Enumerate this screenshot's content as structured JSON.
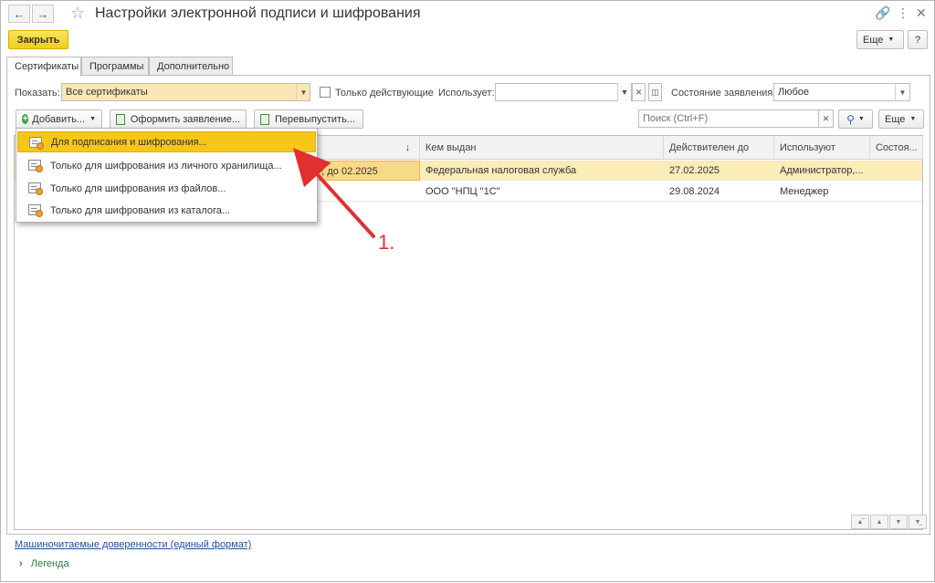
{
  "window": {
    "title": "Настройки электронной подписи и шифрования"
  },
  "commandbar": {
    "close_label": "Закрыть",
    "more_label": "Еще",
    "help_label": "?"
  },
  "tabs": [
    {
      "label": "Сертификаты",
      "active": true
    },
    {
      "label": "Программы",
      "active": false
    },
    {
      "label": "Дополнительно",
      "active": false
    }
  ],
  "filters": {
    "show_label": "Показать:",
    "show_value": "Все сертификаты",
    "only_active_label": "Только действующие",
    "uses_label": "Использует:",
    "uses_value": "",
    "status_label": "Состояние заявления:",
    "status_value": "Любое"
  },
  "toolbar": {
    "add_label": "Добавить...",
    "apply_label": "Оформить заявление...",
    "reissue_label": "Перевыпустить...",
    "search_placeholder": "Поиск (Ctrl+F)",
    "more_label": "Еще"
  },
  "add_menu": [
    {
      "label": "Для подписания и шифрования...",
      "highlighted": true
    },
    {
      "label": "Только для шифрования из личного хранилища...",
      "highlighted": false
    },
    {
      "label": "Только для шифрования из файлов...",
      "highlighted": false
    },
    {
      "label": "Только для шифрования из каталога...",
      "highlighted": false
    }
  ],
  "table": {
    "sort_indicator": "↓",
    "columns": [
      "Кем выдан",
      "Действителен до",
      "Используют",
      "Состоя..."
    ],
    "rows": [
      {
        "name_tail": "Р, до 02.2025",
        "issuer": "Федеральная налоговая служба",
        "valid_to": "27.02.2025",
        "users": "Администратор,...",
        "state": "",
        "selected": true
      },
      {
        "name_tail": "",
        "issuer": "ООО \"НПЦ \"1С\"",
        "valid_to": "29.08.2024",
        "users": "Менеджер",
        "state": "",
        "selected": false
      }
    ]
  },
  "annotation": {
    "label": "1.",
    "color": "#e03030"
  },
  "footer": {
    "link_label": "Машиночитаемые доверенности (единый формат)",
    "legend_label": "Легенда"
  },
  "colors": {
    "accent_yellow": "#f2cd13",
    "selection": "#fbecb8"
  }
}
